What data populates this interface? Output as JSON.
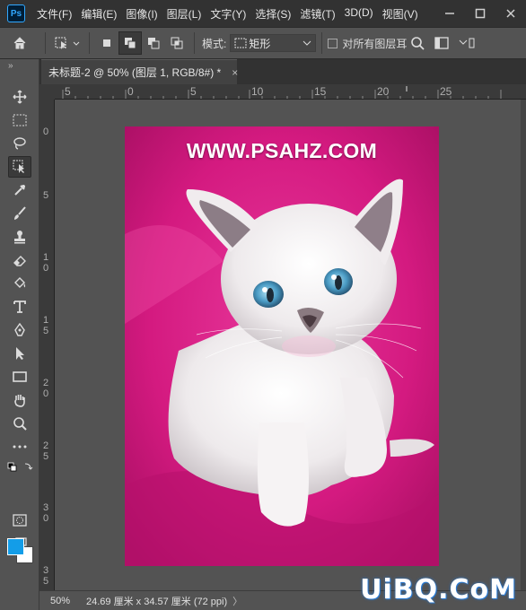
{
  "app": {
    "logo_text": "Ps"
  },
  "menu": [
    "文件(F)",
    "编辑(E)",
    "图像(I)",
    "图层(L)",
    "文字(Y)",
    "选择(S)",
    "滤镜(T)",
    "3D(D)",
    "视图(V)"
  ],
  "window_buttons": {
    "minimize": "—",
    "maximize": "☐",
    "close": "✕"
  },
  "options": {
    "mode_label": "模式:",
    "mode_value": "矩形",
    "sample_all_label": "对所有图层耳"
  },
  "tab": {
    "title": "未标题-2 @ 50% (图层 1, RGB/8#) *",
    "close": "×"
  },
  "ruler": {
    "h_labels": [
      "5",
      "0",
      "5",
      "10",
      "15",
      "20",
      "25"
    ],
    "v_labels": [
      "0",
      "5",
      "1\n0",
      "1\n5",
      "2\n0",
      "2\n5",
      "3\n0",
      "3\n5"
    ]
  },
  "document": {
    "watermark": "WWW.PSAHZ.COM"
  },
  "status": {
    "zoom": "50%",
    "doc_size": "24.69 厘米 x 34.57 厘米 (72 ppi)",
    "arrow": "〉"
  },
  "brand": "UiBQ.CoM",
  "colors": {
    "foreground": "#139de8",
    "background": "#ffffff",
    "canvas_bg": "#d0157e"
  }
}
